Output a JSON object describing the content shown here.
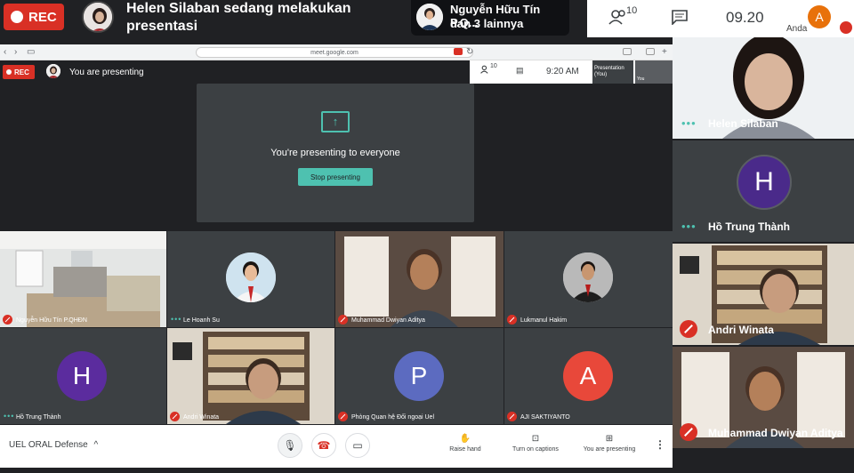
{
  "top": {
    "rec_label": "REC",
    "presenter_text": "Helen Silaban sedang melakukan presentasi",
    "pinned_name": "Nguyễn Hữu Tín P.Q...",
    "pinned_sub": "dan 3 lainnya",
    "people_count": "10",
    "time": "09.20",
    "self_initial": "A",
    "self_label": "Anda"
  },
  "browser": {
    "url": "meet.google.com"
  },
  "meet": {
    "rec_label": "REC",
    "status": "You are presenting",
    "people_count": "10",
    "time": "9:20 AM",
    "presentation_label": "Presentation (You)",
    "self_label": "You",
    "presenting_text": "You're presenting to everyone",
    "stop_button": "Stop presenting"
  },
  "tiles": [
    {
      "name": "Nguyễn Hữu Tín P.QHĐN",
      "initial": "",
      "color": "",
      "muted": true
    },
    {
      "name": "Le Hoanh Su",
      "initial": "",
      "color": "",
      "muted": false
    },
    {
      "name": "Muhammad Dwiyan Aditya",
      "initial": "",
      "color": "",
      "muted": true
    },
    {
      "name": "Lukmanul Hakim",
      "initial": "",
      "color": "",
      "muted": true
    },
    {
      "name": "Hồ Trung Thành",
      "initial": "H",
      "color": "#5b2c9e",
      "muted": false
    },
    {
      "name": "Andri Winata",
      "initial": "",
      "color": "",
      "muted": true
    },
    {
      "name": "Phòng Quan hệ Đối ngoại Uel",
      "initial": "P",
      "color": "#5c6bc0",
      "muted": true
    },
    {
      "name": "AJI SAKTIYANTO",
      "initial": "A",
      "color": "#e8483a",
      "muted": true
    }
  ],
  "bottom": {
    "meeting_name": "UEL ORAL Defense",
    "raise_hand": "Raise hand",
    "captions": "Turn on captions",
    "presenting": "You are presenting"
  },
  "sidebar": [
    {
      "name": "Helen Silaban",
      "initial": "",
      "color": ""
    },
    {
      "name": "Hồ Trung Thành",
      "initial": "H",
      "color": "#4a2a8a"
    },
    {
      "name": "Andri Winata",
      "initial": "",
      "color": ""
    },
    {
      "name": "Muhammad Dwiyan Aditya",
      "initial": "",
      "color": ""
    }
  ]
}
